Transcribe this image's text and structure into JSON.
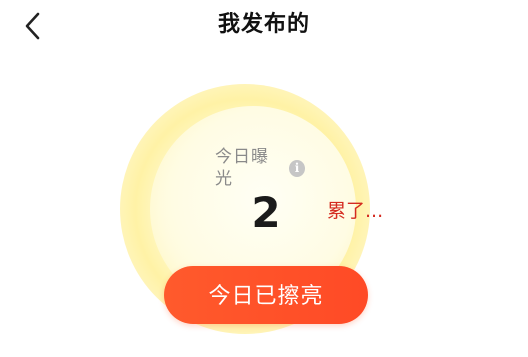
{
  "header": {
    "title": "我发布的",
    "back_icon": "chevron-left-icon"
  },
  "exposure": {
    "label": "今日曝光",
    "info_icon_glyph": "i",
    "count": "2",
    "annotation": "累了..."
  },
  "action": {
    "button_label": "今日已擦亮"
  },
  "colors": {
    "accent": "#ff4f28",
    "annotation": "#d42b20",
    "glow": "#fff3b0"
  }
}
